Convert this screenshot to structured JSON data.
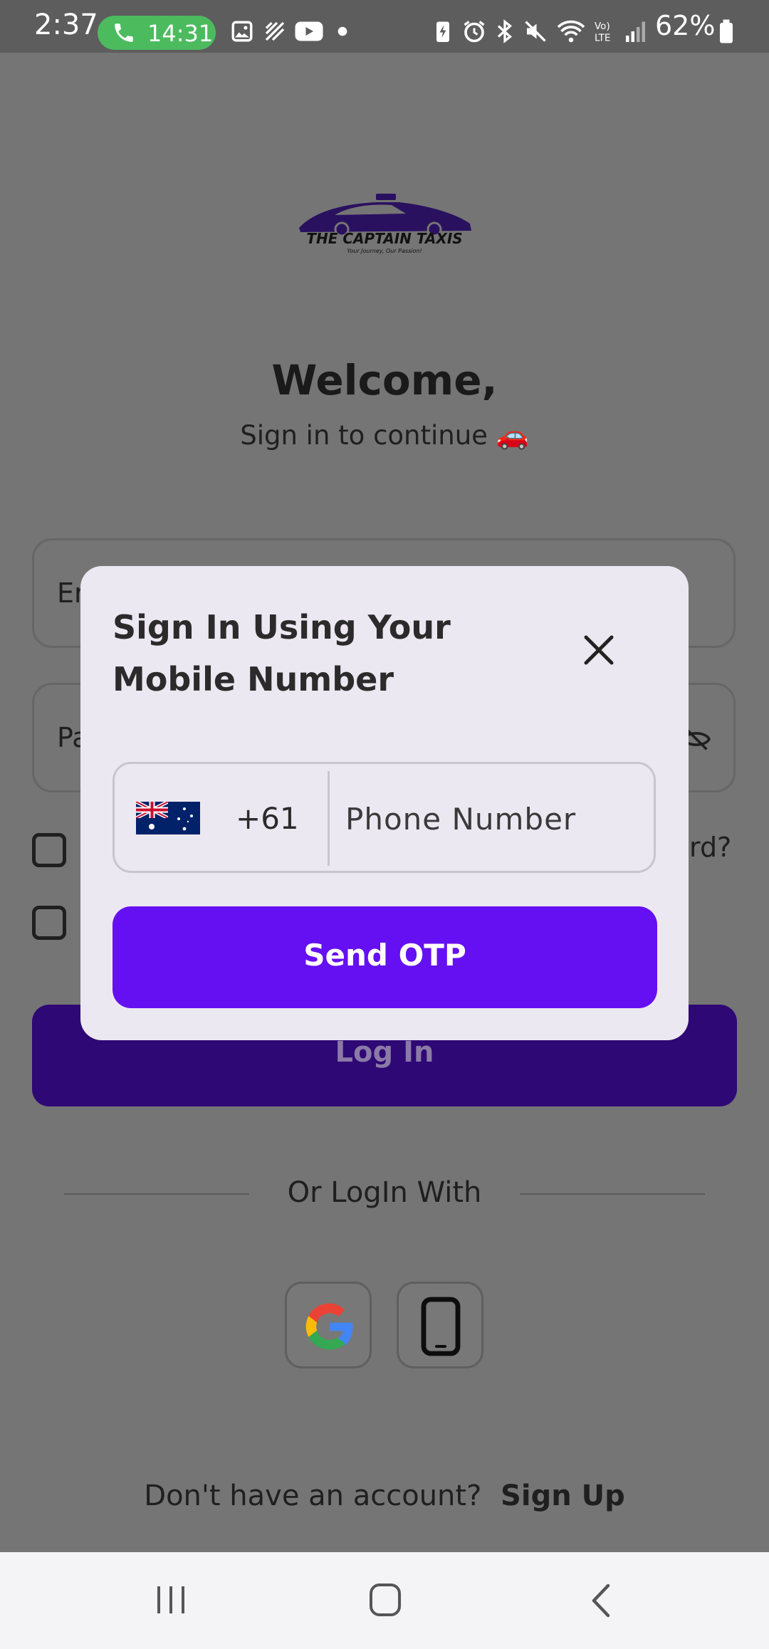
{
  "status_bar": {
    "time": "2:37",
    "call_duration": "14:31",
    "battery": "62%",
    "icons": [
      "phone-icon",
      "image-icon",
      "signal-activity-icon",
      "youtube-icon",
      "dot-icon",
      "battery-saver-icon",
      "alarm-icon",
      "bluetooth-icon",
      "mute-icon",
      "wifi-icon",
      "volte-icon",
      "cell-signal-icon",
      "battery-icon"
    ]
  },
  "background": {
    "logo_text": "THE CAPTAIN TAXIS",
    "logo_tagline": "Your Journey, Our Passion!",
    "welcome_title": "Welcome,",
    "welcome_subtitle": "Sign in to continue 🚗",
    "email_partial": "Er",
    "password_partial": "Pa",
    "forgot_partial": "rd?",
    "login_label": "Log In",
    "or_login_with": "Or LogIn With",
    "signup_prompt": "Don't have an account?",
    "signup_link": "Sign Up"
  },
  "dialog": {
    "title": "Sign In Using Your Mobile Number",
    "country_flag": "australia-flag",
    "dial_code": "+61",
    "phone_placeholder": "Phone Number",
    "send_otp_label": "Send OTP"
  },
  "colors": {
    "accent": "#6510f2",
    "login_button": "#2e0875",
    "call_pill": "#4cbb5e",
    "dialog_bg": "#ece8f1"
  }
}
